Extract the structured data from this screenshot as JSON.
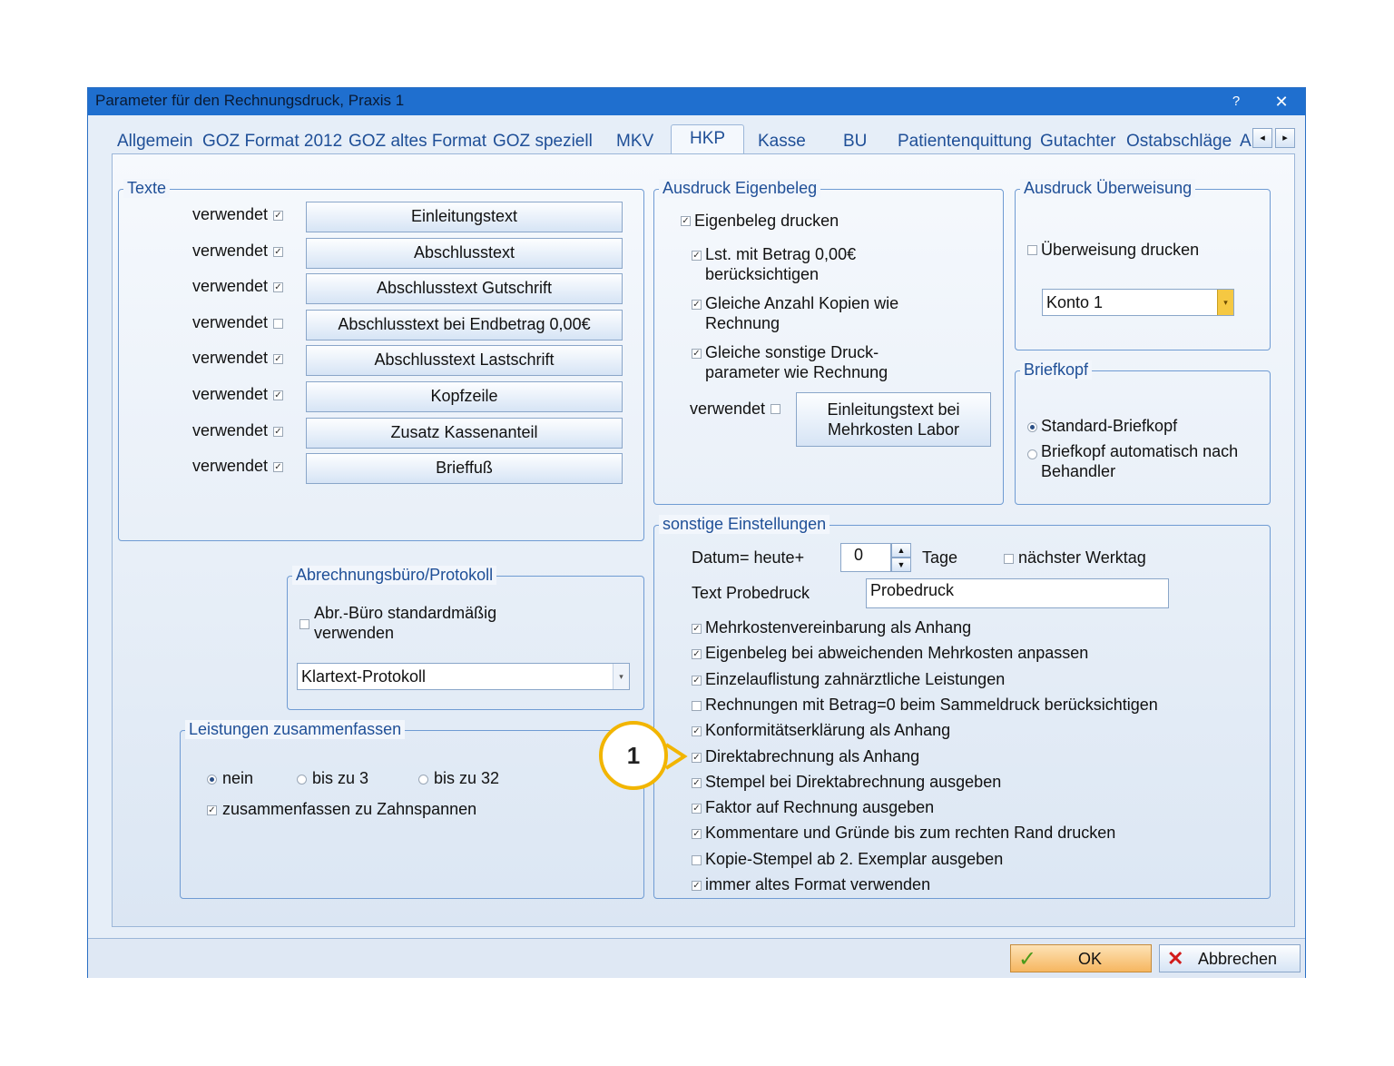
{
  "window": {
    "title": "Parameter für den Rechnungsdruck, Praxis 1",
    "help_label": "?",
    "close_label": "✕"
  },
  "tabs": [
    "Allgemein",
    "GOZ Format 2012",
    "GOZ altes Format",
    "GOZ speziell",
    "MKV",
    "HKP",
    "Kasse",
    "BU",
    "Patientenquittung",
    "Gutachter",
    "Ostabschläge",
    "A"
  ],
  "tab_scroll": {
    "left": "◂",
    "right": "▸"
  },
  "texte": {
    "legend": "Texte",
    "rows": [
      {
        "used_label": "verwendet",
        "checked": true,
        "button": "Einleitungstext"
      },
      {
        "used_label": "verwendet",
        "checked": true,
        "button": "Abschlusstext"
      },
      {
        "used_label": "verwendet",
        "checked": true,
        "button": "Abschlusstext Gutschrift"
      },
      {
        "used_label": "verwendet",
        "checked": false,
        "button": "Abschlusstext bei Endbetrag 0,00€"
      },
      {
        "used_label": "verwendet",
        "checked": true,
        "button": "Abschlusstext Lastschrift"
      },
      {
        "used_label": "verwendet",
        "checked": true,
        "button": "Kopfzeile"
      },
      {
        "used_label": "verwendet",
        "checked": true,
        "button": "Zusatz Kassenanteil"
      },
      {
        "used_label": "verwendet",
        "checked": true,
        "button": "Brieffuß"
      }
    ]
  },
  "eigenbeleg": {
    "legend": "Ausdruck Eigenbeleg",
    "drucken": "Eigenbeleg drucken",
    "lst_line1": "Lst. mit Betrag 0,00€",
    "lst_line2": "berücksichtigen",
    "kopien_line1": "Gleiche Anzahl Kopien wie",
    "kopien_line2": "Rechnung",
    "druck_line1": "Gleiche sonstige Druck-",
    "druck_line2": "parameter wie Rechnung",
    "used_label": "verwendet",
    "button_line1": "Einleitungstext bei",
    "button_line2": "Mehrkosten Labor"
  },
  "ueberweisung": {
    "legend": "Ausdruck Überweisung",
    "drucken": "Überweisung drucken",
    "konto": "Konto 1",
    "arrow": "▾"
  },
  "briefkopf": {
    "legend": "Briefkopf",
    "standard": "Standard-Briefkopf",
    "auto_line1": "Briefkopf automatisch nach",
    "auto_line2": "Behandler"
  },
  "abrechnung": {
    "legend": "Abrechnungsbüro/Protokoll",
    "check_line1": "Abr.-Büro standardmäßig",
    "check_line2": "verwenden",
    "protokoll": "Klartext-Protokoll",
    "arrow": "▾"
  },
  "leistungen": {
    "legend": "Leistungen zusammenfassen",
    "nein": "nein",
    "bis3": "bis zu 3",
    "bis32": "bis zu 32",
    "zahnspannen": "zusammenfassen zu Zahnspannen"
  },
  "sonstige": {
    "legend": "sonstige Einstellungen",
    "datum_label": "Datum= heute+",
    "datum_value": "0",
    "tage_label": "Tage",
    "werktag_label": "nächster Werktag",
    "probedruck_label": "Text Probedruck",
    "probedruck_value": "Probedruck",
    "spin_up": "▲",
    "spin_down": "▼",
    "options": [
      {
        "label": "Mehrkostenvereinbarung als Anhang",
        "checked": true
      },
      {
        "label": "Eigenbeleg bei abweichenden Mehrkosten anpassen",
        "checked": true
      },
      {
        "label": "Einzelauflistung zahnärztliche Leistungen",
        "checked": true
      },
      {
        "label": "Rechnungen mit Betrag=0 beim Sammeldruck berücksichtigen",
        "checked": false
      },
      {
        "label": "Konformitätserklärung als Anhang",
        "checked": true
      },
      {
        "label": "Direktabrechnung als Anhang",
        "checked": true
      },
      {
        "label": "Stempel bei Direktabrechnung ausgeben",
        "checked": true
      },
      {
        "label": "Faktor auf Rechnung ausgeben",
        "checked": true
      },
      {
        "label": "Kommentare und Gründe bis zum rechten Rand drucken",
        "checked": true
      },
      {
        "label": "Kopie-Stempel ab 2. Exemplar ausgeben",
        "checked": false
      },
      {
        "label": "immer altes Format verwenden",
        "checked": true
      }
    ]
  },
  "footer": {
    "ok": "OK",
    "cancel": "Abbrechen",
    "ok_icon": "✓",
    "cancel_icon": "✕"
  },
  "callout": {
    "number": "1"
  },
  "check_mark": "✓",
  "colors": {
    "titlebar": "#1f6fcf",
    "callout": "#f2b500",
    "legend": "#1f4f97"
  }
}
